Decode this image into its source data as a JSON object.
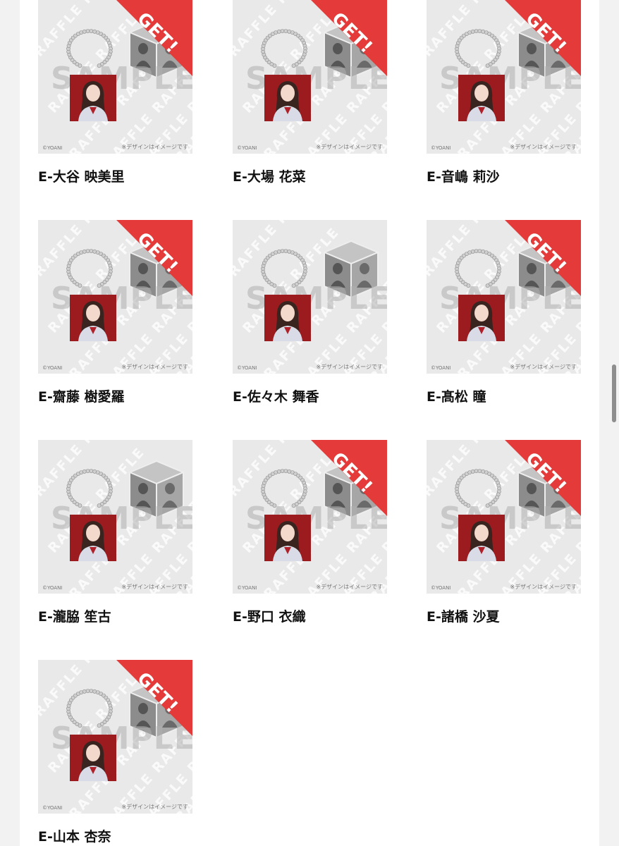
{
  "products": [
    {
      "name": "E-大谷 映美里",
      "got": true
    },
    {
      "name": "E-大場 花菜",
      "got": true
    },
    {
      "name": "E-音嶋 莉沙",
      "got": true
    },
    {
      "name": "E-齋藤 樹愛羅",
      "got": true
    },
    {
      "name": "E-佐々木 舞香",
      "got": false
    },
    {
      "name": "E-髙松 瞳",
      "got": true
    },
    {
      "name": "E-瀧脇 笙古",
      "got": false
    },
    {
      "name": "E-野口 衣織",
      "got": true
    },
    {
      "name": "E-諸橋 沙夏",
      "got": true
    },
    {
      "name": "E-山本 杏奈",
      "got": true
    }
  ],
  "image_text": {
    "badge": "GET!",
    "sample_watermark": "SAMPLE",
    "raffle_watermark": "RAFFLE",
    "copyright": "©YOANI",
    "note": "※デザインはイメージです"
  },
  "colors": {
    "badge_red": "#e53a3a",
    "photo_backdrop": "#9b1b1f",
    "page_bg": "#f2f2f2"
  }
}
